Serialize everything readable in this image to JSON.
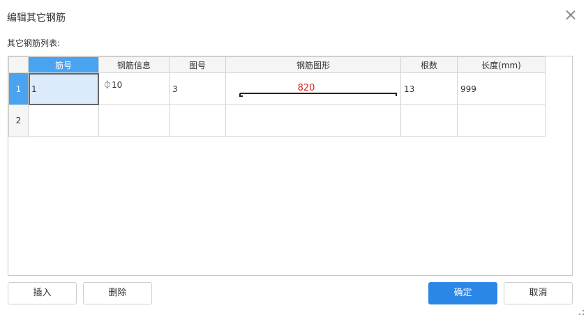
{
  "dialog": {
    "title": "编辑其它钢筋"
  },
  "section": {
    "label": "其它钢筋列表:"
  },
  "table": {
    "columns": [
      "筋号",
      "钢筋信息",
      "图号",
      "钢筋图形",
      "根数",
      "长度(mm)"
    ],
    "rows": [
      {
        "index": "1",
        "bar_no": "1",
        "info": "⏀10",
        "shape_no": "3",
        "shape_value": "820",
        "count": "13",
        "length": "999"
      },
      {
        "index": "2",
        "bar_no": "",
        "info": "",
        "shape_no": "",
        "shape_value": "",
        "count": "",
        "length": ""
      }
    ]
  },
  "buttons": {
    "insert": "插入",
    "delete": "删除",
    "ok": "确定",
    "cancel": "取消"
  },
  "colors": {
    "accent": "#2b86e6",
    "header_active": "#4aa3f0",
    "selected_cell": "#dcebfb",
    "shape_text": "#e02020"
  }
}
